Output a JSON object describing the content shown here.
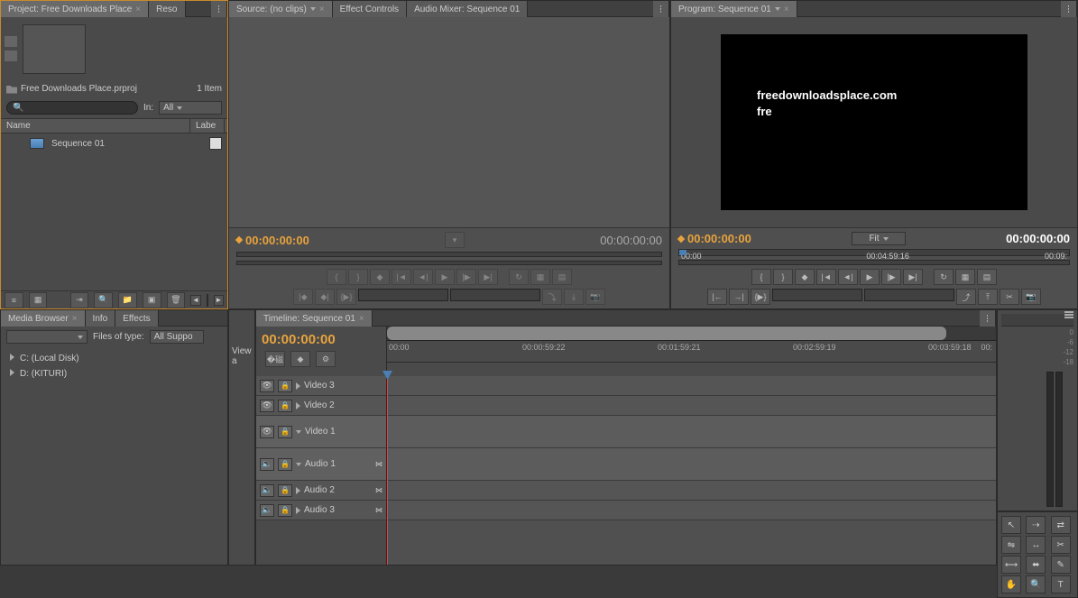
{
  "project": {
    "tab_label": "Project: Free Downloads Place",
    "other_tab": "Reso",
    "filename": "Free Downloads Place.prproj",
    "item_count": "1 Item",
    "in_label": "In:",
    "in_value": "All",
    "col_name": "Name",
    "col_label": "Labe",
    "sequence_name": "Sequence 01"
  },
  "source": {
    "tab_source": "Source: (no clips)",
    "tab_effect": "Effect Controls",
    "tab_audio": "Audio Mixer: Sequence 01",
    "tc_left": "00:00:00:00",
    "tc_right": "00:00:00:00"
  },
  "program": {
    "tab_label": "Program: Sequence 01",
    "watermark1": "freedownloadsplace.com",
    "watermark2": "fre",
    "tc_left": "00:00:00:00",
    "fit_label": "Fit",
    "tc_right": "00:00:00:00",
    "ruler_start": "00:00",
    "ruler_mid": "00:04:59:16",
    "ruler_end": "00:09:"
  },
  "media_browser": {
    "tab_mb": "Media Browser",
    "tab_info": "Info",
    "tab_effects": "Effects",
    "files_of_type": "Files of type:",
    "type_value": "All Suppo",
    "drive_c": "C: (Local Disk)",
    "drive_d": "D: (KITURI)",
    "view_label": "View a"
  },
  "timeline": {
    "tab_label": "Timeline: Sequence 01",
    "playhead_tc": "00:00:00:00",
    "ruler": [
      "00:00",
      "00:00:59:22",
      "00:01:59:21",
      "00:02:59:19",
      "00:03:59:18",
      "00:"
    ],
    "tracks": {
      "v3": "Video 3",
      "v2": "Video 2",
      "v1": "Video 1",
      "a1": "Audio 1",
      "a2": "Audio 2",
      "a3": "Audio 3"
    }
  },
  "meters": {
    "scale": [
      "0",
      "-6",
      "-12",
      "-18"
    ]
  },
  "tools": {
    "title": "T"
  }
}
